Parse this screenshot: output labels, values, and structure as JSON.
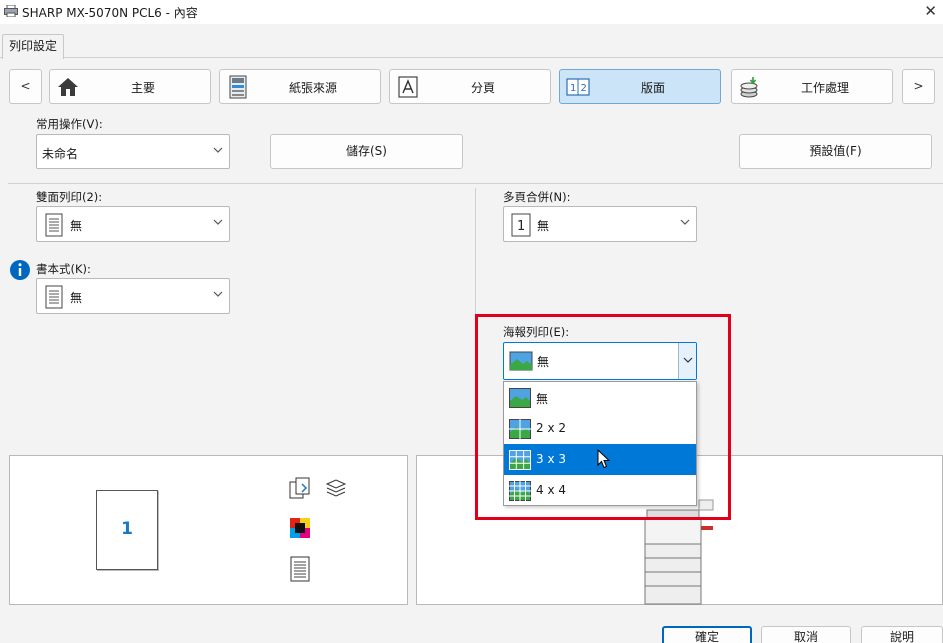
{
  "window": {
    "title": "SHARP MX-5070N PCL6 - 內容",
    "close_glyph": "✕"
  },
  "tabs": [
    {
      "label": "列印設定"
    }
  ],
  "nav": {
    "prev": "<",
    "next": ">",
    "items": [
      {
        "label": "主要",
        "icon": "home-icon"
      },
      {
        "label": "紙張來源",
        "icon": "printer-tray-icon"
      },
      {
        "label": "分頁",
        "icon": "page-a-icon"
      },
      {
        "label": "版面",
        "icon": "layout-1-2-icon",
        "active": true
      },
      {
        "label": "工作處理",
        "icon": "coin-stack-icon"
      }
    ]
  },
  "favorites": {
    "label": "常用操作(V):",
    "value": "未命名",
    "save_label": "儲存(S)",
    "defaults_label": "預設值(F)"
  },
  "duplex": {
    "label": "雙面列印(2):",
    "value": "無"
  },
  "booklet": {
    "label": "書本式(K):",
    "value": "無"
  },
  "nup": {
    "label": "多頁合併(N):",
    "value": "無"
  },
  "poster": {
    "label": "海報列印(E):",
    "value": "無",
    "options": [
      "無",
      "2 x 2",
      "3 x 3",
      "4 x 4"
    ],
    "hovered_option": "3 x 3"
  },
  "preview": {
    "page_number": "1"
  },
  "buttons": {
    "ok": "確定",
    "cancel": "取消",
    "help": "說明"
  },
  "colors": {
    "accent": "#0078d7",
    "highlight_frame": "#e0001a",
    "active_tab": "#cce4f7"
  }
}
